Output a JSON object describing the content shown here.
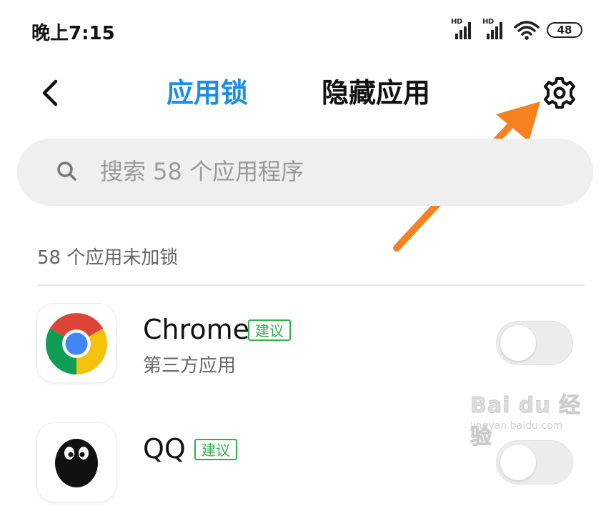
{
  "status_bar": {
    "time": "晚上7:15",
    "signal_label": "HD",
    "battery": "48"
  },
  "nav": {
    "tabs": [
      {
        "label": "应用锁"
      },
      {
        "label": "隐藏应用"
      }
    ]
  },
  "search": {
    "placeholder": "搜索 58 个应用程序"
  },
  "section": {
    "label": "58 个应用未加锁"
  },
  "apps": [
    {
      "name": "Chrome",
      "badge": "建议",
      "subtitle": "第三方应用",
      "locked": false
    },
    {
      "name": "QQ",
      "badge": "建议",
      "locked": false
    }
  ],
  "watermark": {
    "logo": "Bai du 经验",
    "url": "jingyan.baidu.com"
  },
  "colors": {
    "accent": "#1a8ee8",
    "badge": "#2bb34a",
    "arrow": "#f5821f"
  }
}
